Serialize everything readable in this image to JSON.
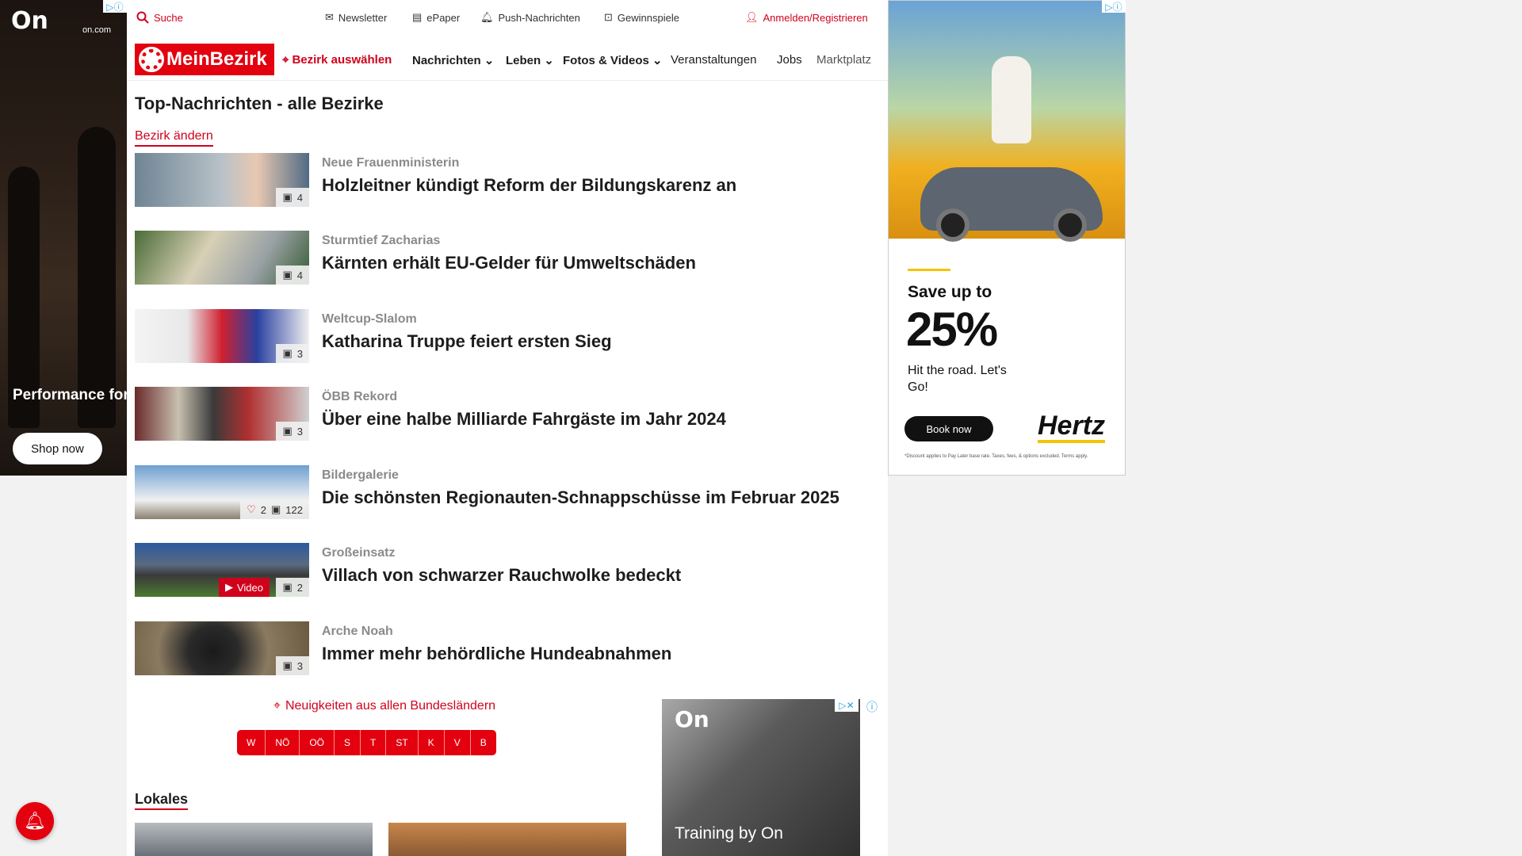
{
  "ad_left": {
    "logo": "On",
    "site": "on.com",
    "headline": "Performance for every run",
    "cta": "Shop now"
  },
  "topbar": {
    "search": "Suche",
    "newsletter": "Newsletter",
    "epaper": "ePaper",
    "push": "Push-Nachrichten",
    "gewinnspiele": "Gewinnspiele",
    "login": "Anmelden/Registrieren"
  },
  "nav": {
    "brand": "MeinBezirk",
    "bezirk": "Bezirk auswählen",
    "items": [
      "Nachrichten",
      "Leben",
      "Fotos & Videos",
      "Veranstaltungen",
      "Jobs",
      "Marktplatz"
    ]
  },
  "page": {
    "title": "Top-Nachrichten - alle Bezirke",
    "change_bezirk": "Bezirk ändern"
  },
  "articles": [
    {
      "kicker": "Neue Frauenministerin",
      "headline": "Holzleitner kündigt Reform der Bildungskarenz an",
      "images": "4"
    },
    {
      "kicker": "Sturmtief Zacharias",
      "headline": "Kärnten erhält EU-Gelder für Umweltschäden",
      "images": "4"
    },
    {
      "kicker": "Weltcup-Slalom",
      "headline": "Katharina Truppe feiert ersten Sieg",
      "images": "3"
    },
    {
      "kicker": "ÖBB Rekord",
      "headline": "Über eine halbe Milliarde Fahrgäste im Jahr 2024",
      "images": "3"
    },
    {
      "kicker": "Bildergalerie",
      "headline": "Die schönsten Regionauten-Schnappschüsse im Februar 2025",
      "images": "122",
      "likes": "2"
    },
    {
      "kicker": "Großeinsatz",
      "headline": "Villach von schwarzer Rauchwolke bedeckt",
      "images": "2",
      "video": "Video"
    },
    {
      "kicker": "Arche Noah",
      "headline": "Immer mehr behördliche Hundeabnahmen",
      "images": "3"
    }
  ],
  "states": {
    "label": "Neuigkeiten aus allen Bundesländern",
    "items": [
      "W",
      "NÖ",
      "OÖ",
      "S",
      "T",
      "ST",
      "K",
      "V",
      "B"
    ]
  },
  "lokales": "Lokales",
  "ad_bottom": {
    "logo": "On",
    "text": "Training by On"
  },
  "ad_right": {
    "save": "Save up to",
    "pct": "25%",
    "sub": "Hit the road. Let's Go!",
    "cta": "Book now",
    "brand": "Hertz",
    "fine": "*Discount applies to Pay Later base rate. Taxes, fees, & options excluded. Terms apply."
  },
  "colors": {
    "brand_red": "#e3000f",
    "link_red": "#d0021b",
    "accent_yellow": "#f5c400"
  }
}
